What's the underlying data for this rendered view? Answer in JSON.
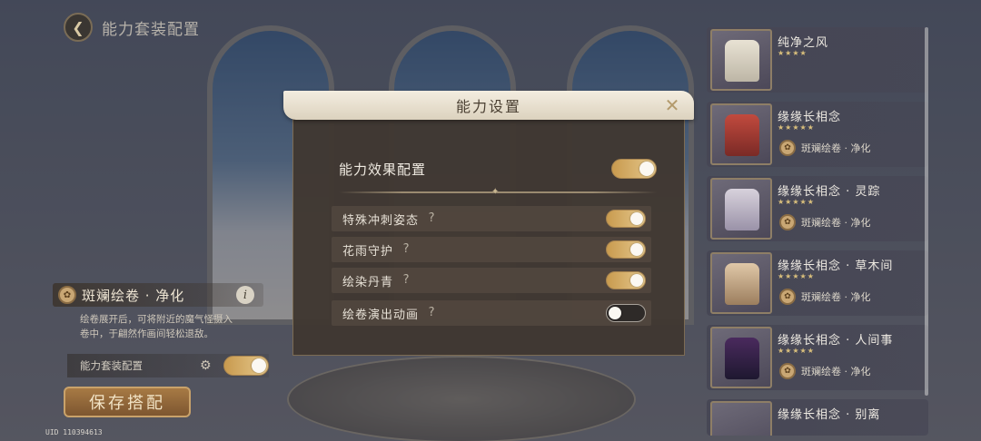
{
  "header": {
    "title": "能力套装配置"
  },
  "skill_panel": {
    "name": "斑斓绘卷 · 净化",
    "description_line1": "绘卷展开后，可将附近的魔气怪摄入",
    "description_line2": "卷中，于翩然作画间轻松退敌。"
  },
  "suit_config": {
    "label": "能力套装配置",
    "enabled": true
  },
  "save_button": {
    "label": "保存搭配"
  },
  "uid": "UID 110394613",
  "modal": {
    "title": "能力设置",
    "main_option": {
      "label": "能力效果配置",
      "enabled": true
    },
    "options": [
      {
        "label": "特殊冲刺姿态",
        "enabled": true
      },
      {
        "label": "花雨守护",
        "enabled": true
      },
      {
        "label": "绘染丹青",
        "enabled": true
      },
      {
        "label": "绘卷演出动画",
        "enabled": false
      }
    ]
  },
  "suits": [
    {
      "name": "纯净之风",
      "stars": "★★★★",
      "ability": ""
    },
    {
      "name": "缘缘长相念",
      "stars": "★★★★★",
      "ability": "斑斓绘卷 · 净化"
    },
    {
      "name": "缘缘长相念 · 灵踪",
      "stars": "★★★★★",
      "ability": "斑斓绘卷 · 净化"
    },
    {
      "name": "缘缘长相念 · 草木间",
      "stars": "★★★★★",
      "ability": "斑斓绘卷 · 净化"
    },
    {
      "name": "缘缘长相念 · 人间事",
      "stars": "★★★★★",
      "ability": "斑斓绘卷 · 净化"
    },
    {
      "name": "缘缘长相念 · 别离",
      "stars": "",
      "ability": ""
    }
  ],
  "colors": {
    "toggle_on": "#e6c98e",
    "toggle_off": "#2e2a28",
    "modal_bg": "#403832",
    "accent_gold": "#c9a26a"
  }
}
